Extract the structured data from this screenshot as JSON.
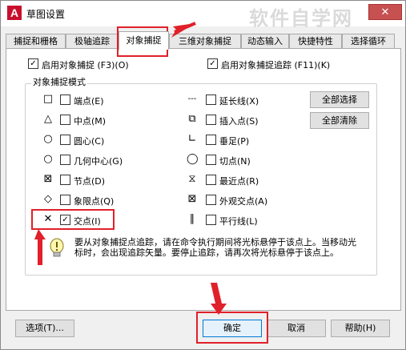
{
  "window": {
    "title": "草图设置",
    "close_symbol": "✕",
    "watermark": "软件自学网",
    "app_icon_letter": "A"
  },
  "tabs": [
    {
      "label": "捕捉和栅格"
    },
    {
      "label": "极轴追踪"
    },
    {
      "label": "对象捕捉"
    },
    {
      "label": "三维对象捕捉"
    },
    {
      "label": "动态输入"
    },
    {
      "label": "快捷特性"
    },
    {
      "label": "选择循环"
    }
  ],
  "top_options": {
    "enable_osnap": {
      "label": "启用对象捕捉 (F3)(O)",
      "checked": "✓"
    },
    "enable_tracking": {
      "label": "启用对象捕捉追踪 (F11)(K)",
      "checked": "✓"
    }
  },
  "group": {
    "title": "对象捕捉模式"
  },
  "left_modes": [
    {
      "symbol": "□",
      "label": "端点(E)",
      "checked": ""
    },
    {
      "symbol": "△",
      "label": "中点(M)",
      "checked": ""
    },
    {
      "symbol": "○",
      "label": "圆心(C)",
      "checked": ""
    },
    {
      "symbol": "○",
      "label": "几何中心(G)",
      "checked": ""
    },
    {
      "symbol": "⊠",
      "label": "节点(D)",
      "checked": ""
    },
    {
      "symbol": "◇",
      "label": "象限点(Q)",
      "checked": ""
    },
    {
      "symbol": "✕",
      "label": "交点(I)",
      "checked": "✓"
    }
  ],
  "right_modes": [
    {
      "symbol": "---",
      "label": "延长线(X)",
      "checked": ""
    },
    {
      "symbol": "⧉",
      "label": "插入点(S)",
      "checked": ""
    },
    {
      "symbol": "∟",
      "label": "垂足(P)",
      "checked": ""
    },
    {
      "symbol": "◯",
      "label": "切点(N)",
      "checked": ""
    },
    {
      "symbol": "⧖",
      "label": "最近点(R)",
      "checked": ""
    },
    {
      "symbol": "⊠",
      "label": "外观交点(A)",
      "checked": ""
    },
    {
      "symbol": "∥",
      "label": "平行线(L)",
      "checked": ""
    }
  ],
  "side_buttons": {
    "select_all": "全部选择",
    "clear_all": "全部清除"
  },
  "tip": "要从对象捕捉点追踪，请在命令执行期间将光标悬停于该点上。当移动光标时，会出现追踪矢量。要停止追踪，请再次将光标悬停于该点上。",
  "footer": {
    "options": "选项(T)...",
    "ok": "确定",
    "cancel": "取消",
    "help": "帮助(H)"
  },
  "colors": {
    "highlight": "#e0202a",
    "close": "#c75050"
  }
}
